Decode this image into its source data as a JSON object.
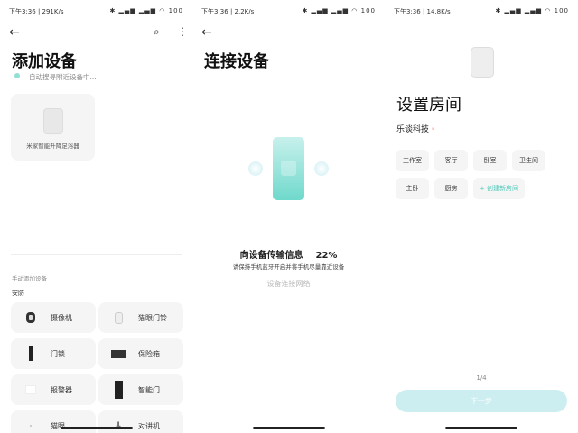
{
  "panel1": {
    "status_left": "下午3:36 | 291K/s",
    "status_right": "✱ ▂▄▆ ▂▄▆ ◠ 100",
    "title": "添加设备",
    "scanning": "自动搜寻附近设备中...",
    "found_device": "米家智能升降足浴器",
    "manual_label": "手动添加设备",
    "category": "安防",
    "devices": [
      {
        "label": "摄像机"
      },
      {
        "label": "猫眼门铃"
      },
      {
        "label": "门锁"
      },
      {
        "label": "保险箱"
      },
      {
        "label": "报警器"
      },
      {
        "label": "智能门"
      },
      {
        "label": "猫眼"
      },
      {
        "label": "对讲机"
      }
    ]
  },
  "panel2": {
    "status_left": "下午3:36 | 2.2K/s",
    "status_right": "✱ ▂▄▆ ▂▄▆ ◠ 100",
    "title": "连接设备",
    "progress_text": "向设备传输信息",
    "progress_percent": "22%",
    "hint": "请保持手机蓝牙开启并将手机尽量靠近设备",
    "step": "设备连接网络"
  },
  "panel3": {
    "status_left": "下午3:36 | 14.8K/s",
    "status_right": "✱ ▂▄▆ ▂▄▆ ◠ 100",
    "title": "设置房间",
    "home": "乐谈科技",
    "rooms": [
      "工作室",
      "客厅",
      "卧室",
      "卫生间",
      "主卧",
      "厨房"
    ],
    "create_room": "+ 创建新房间",
    "page": "1/4",
    "next": "下一步"
  },
  "colors": {
    "accent": "#4cc9b8",
    "button": "#cdeef0"
  }
}
